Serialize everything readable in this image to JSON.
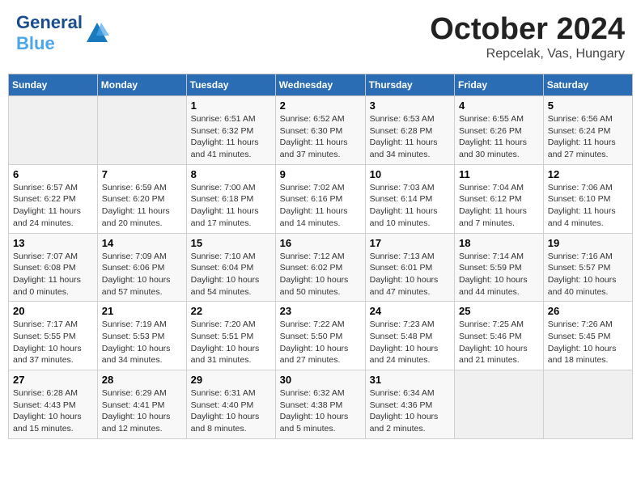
{
  "header": {
    "logo_general": "General",
    "logo_blue": "Blue",
    "month_title": "October 2024",
    "subtitle": "Repcelak, Vas, Hungary"
  },
  "calendar": {
    "days_of_week": [
      "Sunday",
      "Monday",
      "Tuesday",
      "Wednesday",
      "Thursday",
      "Friday",
      "Saturday"
    ],
    "weeks": [
      [
        {
          "day": "",
          "info": ""
        },
        {
          "day": "",
          "info": ""
        },
        {
          "day": "1",
          "info": "Sunrise: 6:51 AM\nSunset: 6:32 PM\nDaylight: 11 hours and 41 minutes."
        },
        {
          "day": "2",
          "info": "Sunrise: 6:52 AM\nSunset: 6:30 PM\nDaylight: 11 hours and 37 minutes."
        },
        {
          "day": "3",
          "info": "Sunrise: 6:53 AM\nSunset: 6:28 PM\nDaylight: 11 hours and 34 minutes."
        },
        {
          "day": "4",
          "info": "Sunrise: 6:55 AM\nSunset: 6:26 PM\nDaylight: 11 hours and 30 minutes."
        },
        {
          "day": "5",
          "info": "Sunrise: 6:56 AM\nSunset: 6:24 PM\nDaylight: 11 hours and 27 minutes."
        }
      ],
      [
        {
          "day": "6",
          "info": "Sunrise: 6:57 AM\nSunset: 6:22 PM\nDaylight: 11 hours and 24 minutes."
        },
        {
          "day": "7",
          "info": "Sunrise: 6:59 AM\nSunset: 6:20 PM\nDaylight: 11 hours and 20 minutes."
        },
        {
          "day": "8",
          "info": "Sunrise: 7:00 AM\nSunset: 6:18 PM\nDaylight: 11 hours and 17 minutes."
        },
        {
          "day": "9",
          "info": "Sunrise: 7:02 AM\nSunset: 6:16 PM\nDaylight: 11 hours and 14 minutes."
        },
        {
          "day": "10",
          "info": "Sunrise: 7:03 AM\nSunset: 6:14 PM\nDaylight: 11 hours and 10 minutes."
        },
        {
          "day": "11",
          "info": "Sunrise: 7:04 AM\nSunset: 6:12 PM\nDaylight: 11 hours and 7 minutes."
        },
        {
          "day": "12",
          "info": "Sunrise: 7:06 AM\nSunset: 6:10 PM\nDaylight: 11 hours and 4 minutes."
        }
      ],
      [
        {
          "day": "13",
          "info": "Sunrise: 7:07 AM\nSunset: 6:08 PM\nDaylight: 11 hours and 0 minutes."
        },
        {
          "day": "14",
          "info": "Sunrise: 7:09 AM\nSunset: 6:06 PM\nDaylight: 10 hours and 57 minutes."
        },
        {
          "day": "15",
          "info": "Sunrise: 7:10 AM\nSunset: 6:04 PM\nDaylight: 10 hours and 54 minutes."
        },
        {
          "day": "16",
          "info": "Sunrise: 7:12 AM\nSunset: 6:02 PM\nDaylight: 10 hours and 50 minutes."
        },
        {
          "day": "17",
          "info": "Sunrise: 7:13 AM\nSunset: 6:01 PM\nDaylight: 10 hours and 47 minutes."
        },
        {
          "day": "18",
          "info": "Sunrise: 7:14 AM\nSunset: 5:59 PM\nDaylight: 10 hours and 44 minutes."
        },
        {
          "day": "19",
          "info": "Sunrise: 7:16 AM\nSunset: 5:57 PM\nDaylight: 10 hours and 40 minutes."
        }
      ],
      [
        {
          "day": "20",
          "info": "Sunrise: 7:17 AM\nSunset: 5:55 PM\nDaylight: 10 hours and 37 minutes."
        },
        {
          "day": "21",
          "info": "Sunrise: 7:19 AM\nSunset: 5:53 PM\nDaylight: 10 hours and 34 minutes."
        },
        {
          "day": "22",
          "info": "Sunrise: 7:20 AM\nSunset: 5:51 PM\nDaylight: 10 hours and 31 minutes."
        },
        {
          "day": "23",
          "info": "Sunrise: 7:22 AM\nSunset: 5:50 PM\nDaylight: 10 hours and 27 minutes."
        },
        {
          "day": "24",
          "info": "Sunrise: 7:23 AM\nSunset: 5:48 PM\nDaylight: 10 hours and 24 minutes."
        },
        {
          "day": "25",
          "info": "Sunrise: 7:25 AM\nSunset: 5:46 PM\nDaylight: 10 hours and 21 minutes."
        },
        {
          "day": "26",
          "info": "Sunrise: 7:26 AM\nSunset: 5:45 PM\nDaylight: 10 hours and 18 minutes."
        }
      ],
      [
        {
          "day": "27",
          "info": "Sunrise: 6:28 AM\nSunset: 4:43 PM\nDaylight: 10 hours and 15 minutes."
        },
        {
          "day": "28",
          "info": "Sunrise: 6:29 AM\nSunset: 4:41 PM\nDaylight: 10 hours and 12 minutes."
        },
        {
          "day": "29",
          "info": "Sunrise: 6:31 AM\nSunset: 4:40 PM\nDaylight: 10 hours and 8 minutes."
        },
        {
          "day": "30",
          "info": "Sunrise: 6:32 AM\nSunset: 4:38 PM\nDaylight: 10 hours and 5 minutes."
        },
        {
          "day": "31",
          "info": "Sunrise: 6:34 AM\nSunset: 4:36 PM\nDaylight: 10 hours and 2 minutes."
        },
        {
          "day": "",
          "info": ""
        },
        {
          "day": "",
          "info": ""
        }
      ]
    ]
  }
}
